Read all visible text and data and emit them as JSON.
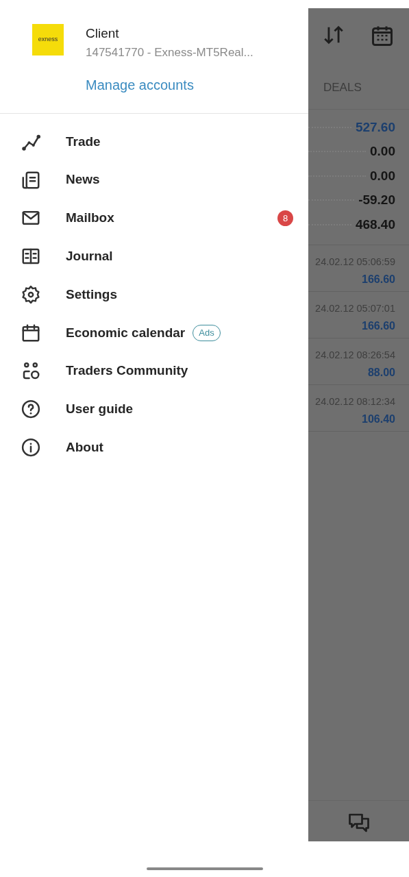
{
  "drawer": {
    "account": {
      "logo_text": "exness",
      "name": "Client",
      "account_line": "147541770 - Exness-MT5Real...",
      "manage_link": "Manage accounts"
    },
    "menu": [
      {
        "label": "Trade"
      },
      {
        "label": "News"
      },
      {
        "label": "Mailbox",
        "badge": "8"
      },
      {
        "label": "Journal"
      },
      {
        "label": "Settings"
      },
      {
        "label": "Economic calendar",
        "tag": "Ads"
      },
      {
        "label": "Traders Community"
      },
      {
        "label": "User guide"
      },
      {
        "label": "About"
      }
    ]
  },
  "background": {
    "tab": "DEALS",
    "summary": [
      {
        "value": "527.60",
        "color": "#1c3f6e"
      },
      {
        "value": "0.00",
        "color": "#151515"
      },
      {
        "value": "0.00",
        "color": "#151515"
      },
      {
        "value": "-59.20",
        "color": "#151515"
      },
      {
        "value": "468.40",
        "color": "#151515"
      }
    ],
    "deals": [
      {
        "time": "24.02.12 05:06:59",
        "amount": "166.60"
      },
      {
        "time": "24.02.12 05:07:01",
        "amount": "166.60"
      },
      {
        "time": "24.02.12 08:26:54",
        "amount": "88.00"
      },
      {
        "time": "24.02.12 08:12:34",
        "amount": "106.40"
      }
    ]
  }
}
